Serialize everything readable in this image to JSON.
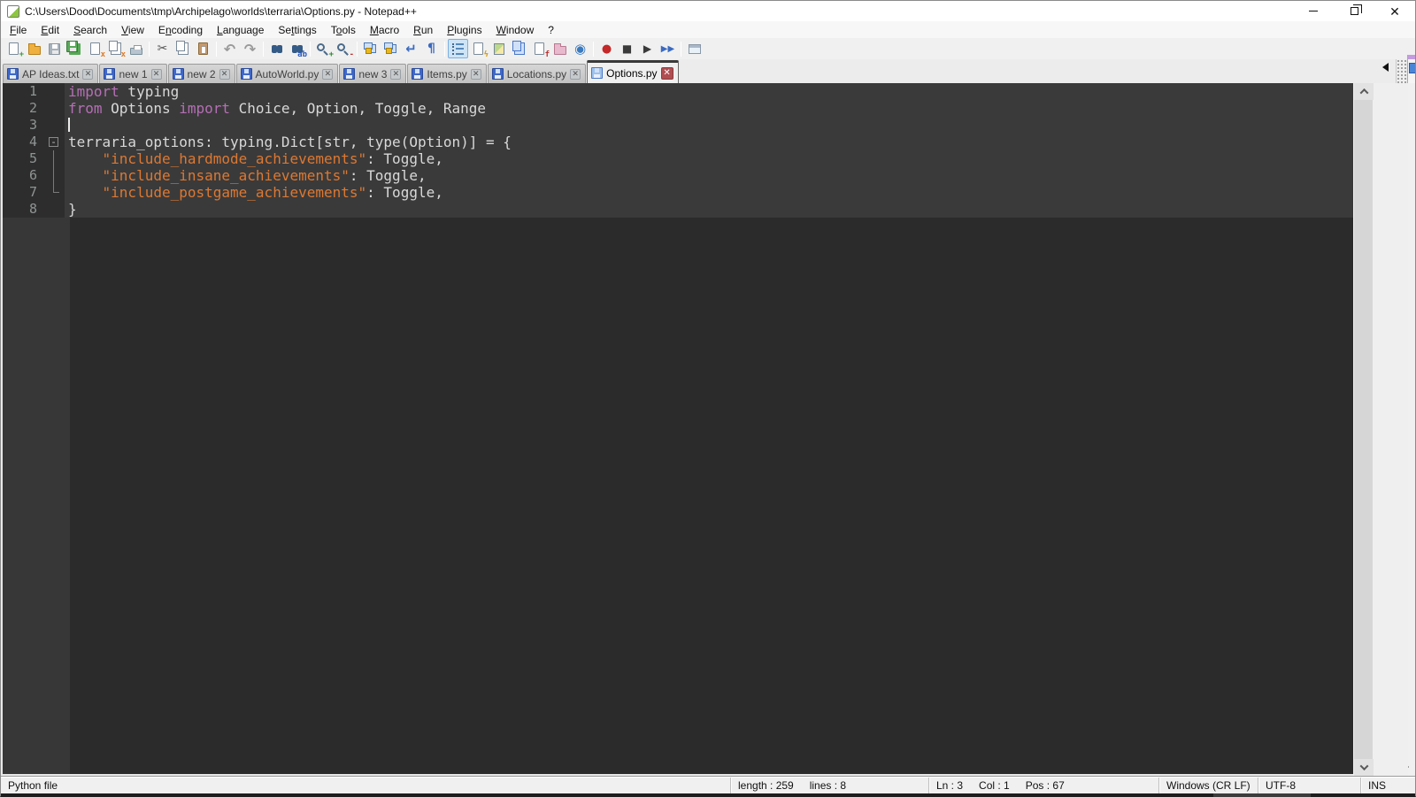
{
  "window": {
    "title": "C:\\Users\\Dood\\Documents\\tmp\\Archipelago\\worlds\\terraria\\Options.py - Notepad++",
    "controls": {
      "minimize": "minimize",
      "restore": "restore-down",
      "close": "close"
    }
  },
  "menu": {
    "items": [
      {
        "label": "File",
        "u": 0
      },
      {
        "label": "Edit",
        "u": 0
      },
      {
        "label": "Search",
        "u": 0
      },
      {
        "label": "View",
        "u": 0
      },
      {
        "label": "Encoding",
        "u": 1
      },
      {
        "label": "Language",
        "u": 0
      },
      {
        "label": "Settings",
        "u": 2
      },
      {
        "label": "Tools",
        "u": 1
      },
      {
        "label": "Macro",
        "u": 0
      },
      {
        "label": "Run",
        "u": 0
      },
      {
        "label": "Plugins",
        "u": 0
      },
      {
        "label": "Window",
        "u": 0
      },
      {
        "label": "?",
        "u": -1
      }
    ]
  },
  "toolbar": {
    "buttons": [
      {
        "name": "new-file",
        "type": "doc",
        "badge": "+",
        "badgeColor": "#3a9a3a"
      },
      {
        "name": "open-file",
        "type": "folder"
      },
      {
        "name": "save",
        "type": "floppy",
        "fill": "#a8b2bc",
        "stroke": "#8a949e"
      },
      {
        "name": "save-all",
        "type": "floppy2",
        "fill": "#58a858",
        "stroke": "#3a7a3a"
      },
      {
        "name": "close-file",
        "type": "doc",
        "badge": "x",
        "badgeColor": "#e07820"
      },
      {
        "name": "close-all-files",
        "type": "doc2",
        "badge": "x",
        "badgeColor": "#e07820"
      },
      {
        "name": "print",
        "type": "printer"
      },
      {
        "type": "sep"
      },
      {
        "name": "cut",
        "type": "glyph",
        "glyph": "✂",
        "color": "#555555",
        "size": 14
      },
      {
        "name": "copy",
        "type": "doc2"
      },
      {
        "name": "paste",
        "type": "paste"
      },
      {
        "type": "sep"
      },
      {
        "name": "undo",
        "type": "glyph",
        "glyph": "↶",
        "color": "#9a9a9a",
        "size": 16,
        "bold": true
      },
      {
        "name": "redo",
        "type": "glyph",
        "glyph": "↷",
        "color": "#9a9a9a",
        "size": 16,
        "bold": true
      },
      {
        "type": "sep"
      },
      {
        "name": "find",
        "type": "binoc"
      },
      {
        "name": "replace",
        "type": "binoc",
        "badge": "ab",
        "badgeColor": "#2a5ac0"
      },
      {
        "type": "sep"
      },
      {
        "name": "zoom-in",
        "type": "mag",
        "badge": "+",
        "badgeColor": "#2a8a2a"
      },
      {
        "name": "zoom-out",
        "type": "mag",
        "badge": "-",
        "badgeColor": "#c03030"
      },
      {
        "type": "sep"
      },
      {
        "name": "synchronize-vertical-scrolling",
        "type": "sync"
      },
      {
        "name": "synchronize-horizontal-scrolling",
        "type": "sync"
      },
      {
        "name": "word-wrap",
        "type": "glyph",
        "glyph": "↵",
        "color": "#3a6ac0",
        "size": 15,
        "bold": true
      },
      {
        "name": "show-all-characters",
        "type": "glyph",
        "glyph": "¶",
        "color": "#3a6ac0",
        "size": 14,
        "bold": true
      },
      {
        "type": "sep"
      },
      {
        "name": "show-indent-guide",
        "type": "indent",
        "active": true
      },
      {
        "name": "user-defined-language",
        "type": "doc",
        "badge": "ϟ",
        "badgeColor": "#d8a010"
      },
      {
        "name": "document-map",
        "type": "map"
      },
      {
        "name": "document-list",
        "type": "doc2blue"
      },
      {
        "name": "function-list",
        "type": "doc",
        "badge": "f",
        "badgeColor": "#c03030"
      },
      {
        "name": "folder-as-workspace",
        "type": "folderpink"
      },
      {
        "name": "monitoring",
        "type": "glyph",
        "glyph": "◉",
        "color": "#3a7ac0",
        "size": 15
      },
      {
        "type": "sep"
      },
      {
        "name": "start-recording-macro",
        "type": "glyph",
        "glyph": "●",
        "color": "#c42828",
        "size": 13
      },
      {
        "name": "stop-recording-macro",
        "type": "glyph",
        "glyph": "■",
        "color": "#3a3a3a",
        "size": 12
      },
      {
        "name": "playback-macro",
        "type": "glyph",
        "glyph": "▶",
        "color": "#3a3a3a",
        "size": 12
      },
      {
        "name": "run-macro-multiple-times",
        "type": "glyph",
        "glyph": "▶▶",
        "color": "#3a6ac0",
        "size": 10,
        "bold": true
      },
      {
        "type": "sep"
      },
      {
        "name": "save-recorded-macro",
        "type": "win"
      }
    ]
  },
  "tabs": {
    "items": [
      {
        "label": "AP Ideas.txt",
        "active": false
      },
      {
        "label": "new 1",
        "active": false
      },
      {
        "label": "new 2",
        "active": false
      },
      {
        "label": "AutoWorld.py",
        "active": false
      },
      {
        "label": "new 3",
        "active": false
      },
      {
        "label": "Items.py",
        "active": false
      },
      {
        "label": "Locations.py",
        "active": false
      },
      {
        "label": "Options.py",
        "active": true
      }
    ]
  },
  "editor": {
    "lines": [
      {
        "num": "1",
        "fold": null,
        "tokens": [
          [
            "kw",
            "import"
          ],
          [
            "def",
            " typing"
          ]
        ]
      },
      {
        "num": "2",
        "fold": null,
        "tokens": [
          [
            "kw",
            "from"
          ],
          [
            "def",
            " Options "
          ],
          [
            "kw",
            "import"
          ],
          [
            "def",
            " Choice, Option, Toggle, Range"
          ]
        ]
      },
      {
        "num": "3",
        "fold": null,
        "caret": true,
        "tokens": []
      },
      {
        "num": "4",
        "fold": "box",
        "tokens": [
          [
            "def",
            "terraria_options: typing.Dict[str, type(Option)] = {"
          ]
        ]
      },
      {
        "num": "5",
        "fold": "line",
        "tokens": [
          [
            "def",
            "    "
          ],
          [
            "str",
            "\"include_hardmode_achievements\""
          ],
          [
            "def",
            ": Toggle,"
          ]
        ]
      },
      {
        "num": "6",
        "fold": "line",
        "tokens": [
          [
            "def",
            "    "
          ],
          [
            "str",
            "\"include_insane_achievements\""
          ],
          [
            "def",
            ": Toggle,"
          ]
        ]
      },
      {
        "num": "7",
        "fold": "end",
        "tokens": [
          [
            "def",
            "    "
          ],
          [
            "str",
            "\"include_postgame_achievements\""
          ],
          [
            "def",
            ": Toggle,"
          ]
        ]
      },
      {
        "num": "8",
        "fold": null,
        "tokens": [
          [
            "def",
            "}"
          ]
        ]
      }
    ],
    "fold_box_glyph": "-"
  },
  "status": {
    "doc_type": "Python file",
    "length_label": "length : 259",
    "lines_label": "lines : 8",
    "ln_label": "Ln : 3",
    "col_label": "Col : 1",
    "pos_label": "Pos : 67",
    "eol": "Windows (CR LF)",
    "encoding": "UTF-8",
    "mode": "INS"
  },
  "colors": {
    "keyword": "#b56fb5",
    "string": "#dd7832",
    "default_text": "#d8d8d8",
    "editor_bg": "#3a3a3a",
    "gutter_bg": "#2d2d2d",
    "active_tab_close": "#b04e52"
  }
}
